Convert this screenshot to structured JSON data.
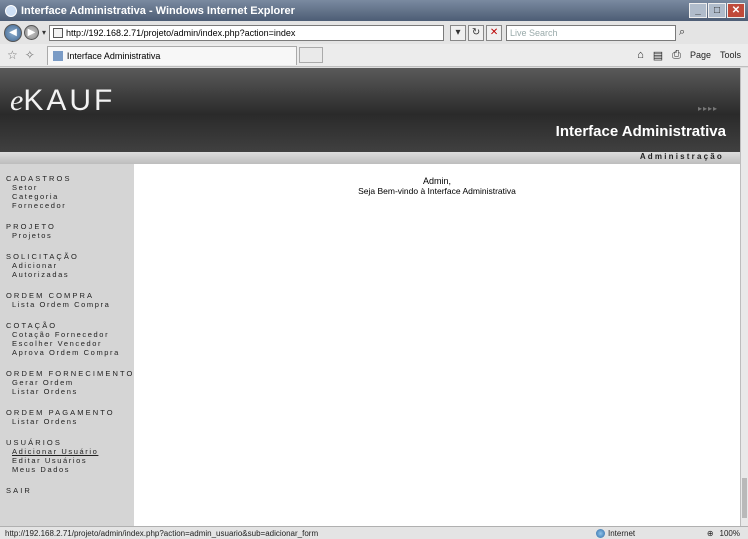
{
  "window": {
    "title": "Interface Administrativa - Windows Internet Explorer",
    "min": "_",
    "max": "□",
    "close": "✕"
  },
  "address_bar": {
    "url": "http://192.168.2.71/projeto/admin/index.php?action=index",
    "search_placeholder": "Live Search",
    "back": "◀",
    "forward": "▶",
    "dropdown": "▾",
    "refresh": "↻",
    "stop": "✕",
    "search_icon": "⌕"
  },
  "tab_bar": {
    "tab_title": "Interface Administrativa",
    "home": "⌂",
    "feeds": "▤",
    "print": "⎙",
    "page": "Page",
    "tools": "Tools"
  },
  "page": {
    "logo_prefix": "e",
    "logo_main": "KAUF",
    "header_title": "Interface Administrativa",
    "header_arrows": "▸▸▸▸",
    "subbar_label": "Administração",
    "welcome_name": "Admin,",
    "welcome_text": "Seja Bem-vindo à Interface Administrativa"
  },
  "sidebar": {
    "sections": [
      {
        "title": "CADASTROS",
        "items": [
          "Setor",
          "Categoria",
          "Fornecedor"
        ]
      },
      {
        "title": "PROJETO",
        "items": [
          "Projetos"
        ]
      },
      {
        "title": "SOLICITAÇÃO",
        "items": [
          "Adicionar",
          "Autorizadas"
        ]
      },
      {
        "title": "ORDEM COMPRA",
        "items": [
          "Lista Ordem Compra"
        ]
      },
      {
        "title": "COTAÇÃO",
        "items": [
          "Cotação Fornecedor",
          "Escolher Vencedor",
          "Aprova Ordem Compra"
        ]
      },
      {
        "title": "ORDEM FORNECIMENTO",
        "items": [
          "Gerar Ordem",
          "Listar Ordens"
        ]
      },
      {
        "title": "ORDEM PAGAMENTO",
        "items": [
          "Listar Ordens"
        ]
      },
      {
        "title": "USUÁRIOS",
        "items": [
          "Adicionar Usuário",
          "Editar Usuários",
          "Meus Dados"
        ]
      },
      {
        "title": "SAIR",
        "items": []
      }
    ]
  },
  "status_bar": {
    "url": "http://192.168.2.71/projeto/admin/index.php?action=admin_usuario&sub=adicionar_form",
    "zone": "Internet",
    "zoom": "100%"
  }
}
